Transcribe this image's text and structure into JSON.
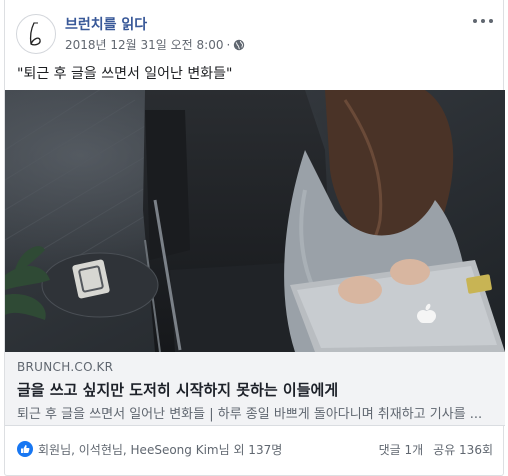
{
  "post": {
    "page_name": "브런치를 읽다",
    "timestamp": "2018년 12월 31일 오전 8:00",
    "meta_separator": "·",
    "audience_icon": "globe-icon",
    "more_icon": "more-options-icon",
    "text": "\"퇴근 후 글을 쓰면서 일어난 변화들\""
  },
  "link_preview": {
    "domain": "BRUNCH.CO.KR",
    "title": "글을 쓰고 싶지만 도저히 시작하지 못하는 이들에게",
    "description": "퇴근 후 글을 쓰면서 일어난 변화들 | 하루 종일 바쁘게 돌아다니며 취재하고 기사를 ..."
  },
  "reactions": {
    "icon": "like-icon",
    "summary": "회원님, 이석현님, HeeSeong Kim님 외 137명",
    "comments": "댓글 1개",
    "shares": "공유 136회"
  },
  "colors": {
    "link_blue": "#385898",
    "like_blue": "#1877f2",
    "preview_bg": "#f2f3f5",
    "secondary_text": "#606770"
  }
}
